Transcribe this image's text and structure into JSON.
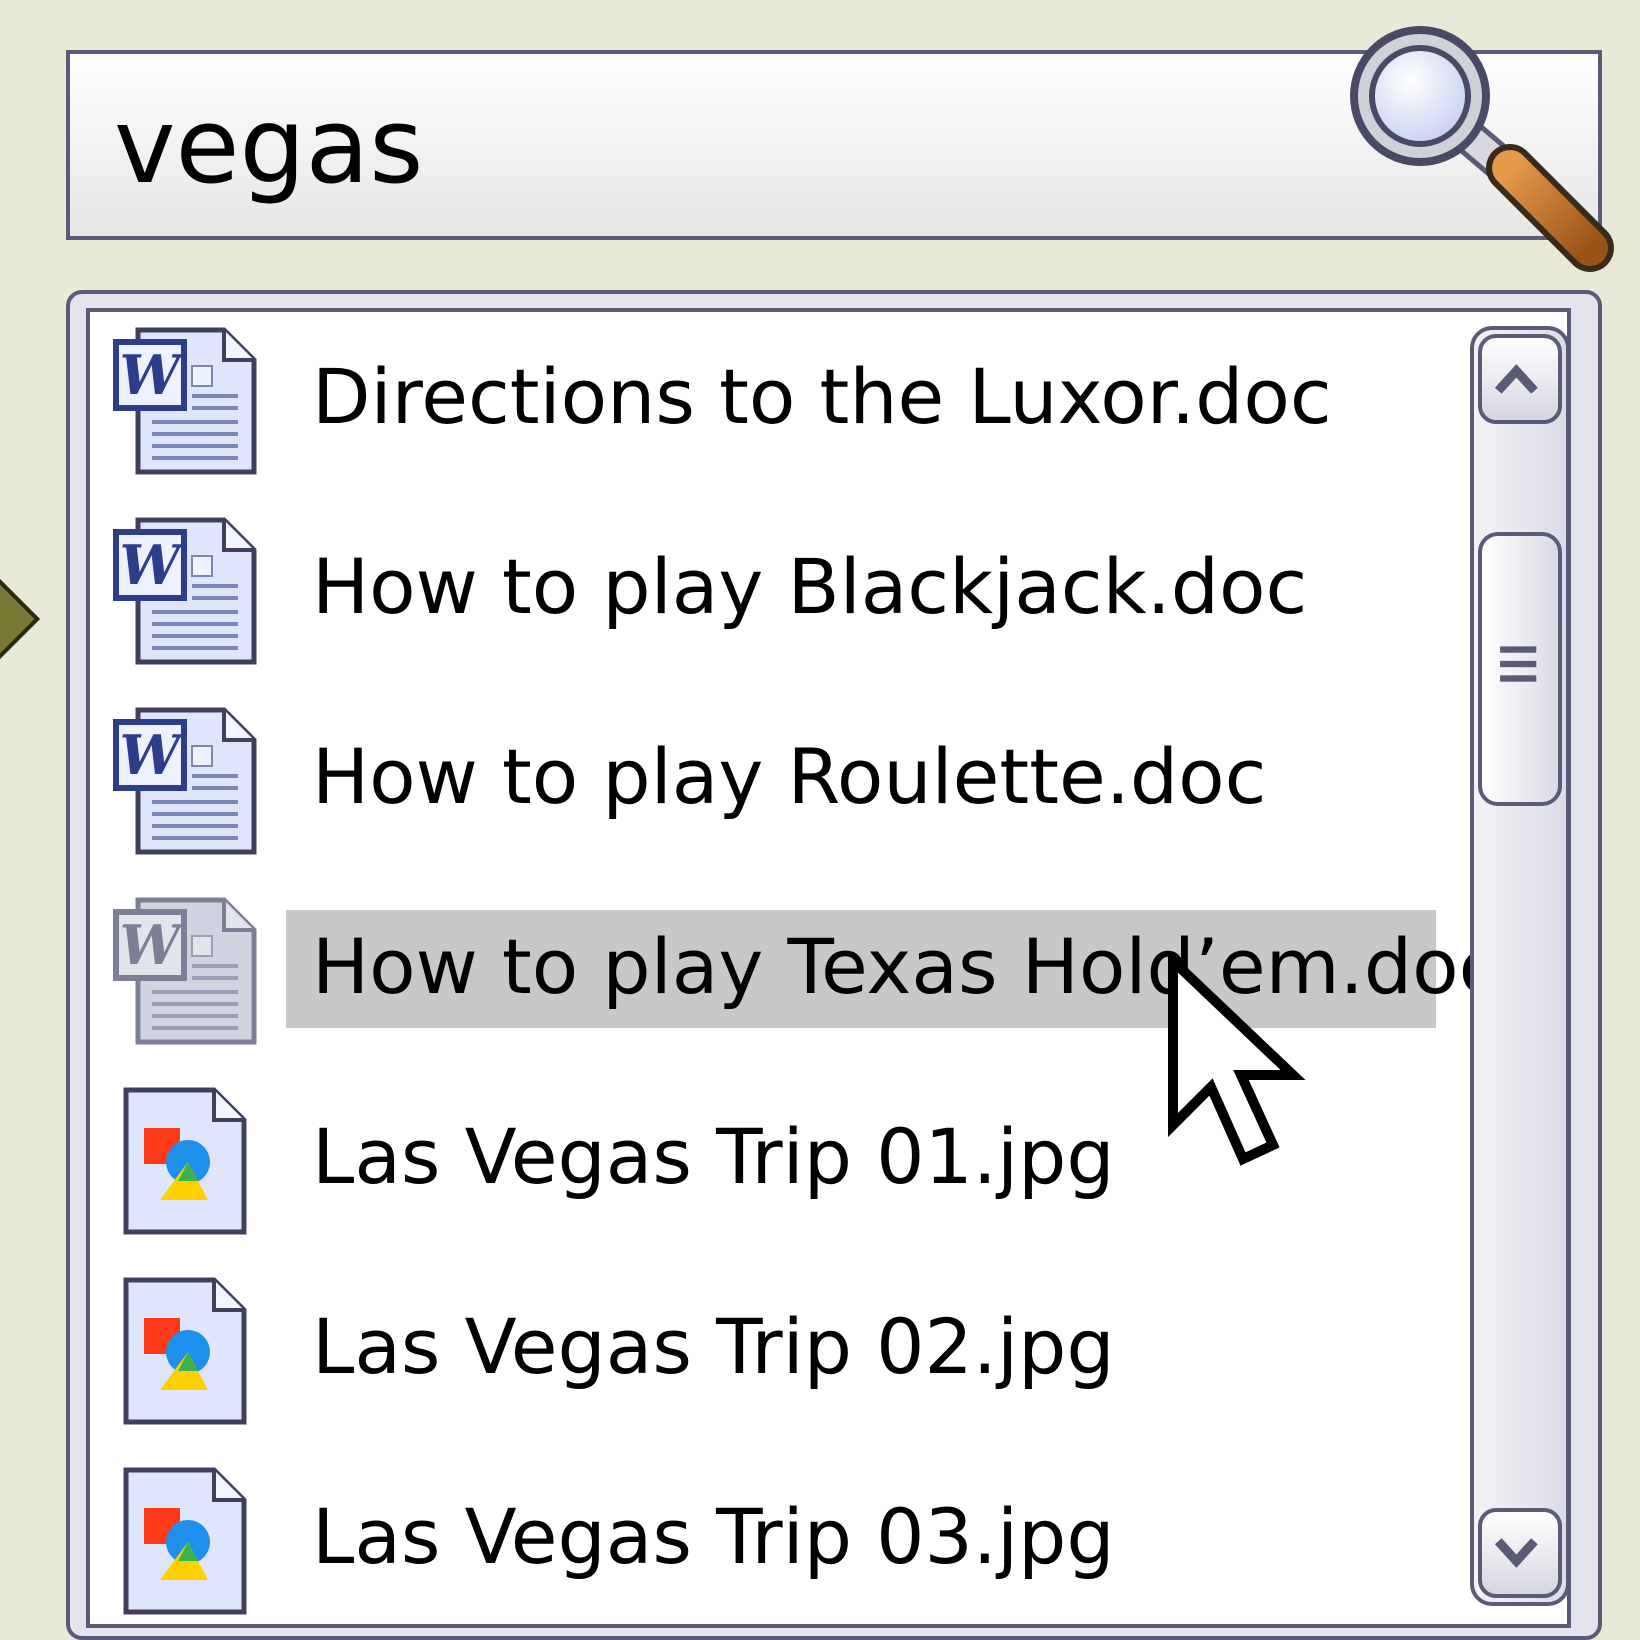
{
  "search": {
    "value": "vegas",
    "icon": "magnifier-icon"
  },
  "results": {
    "items": [
      {
        "label": "Directions to the Luxor.doc",
        "type": "word-doc",
        "selected": false
      },
      {
        "label": "How to play Blackjack.doc",
        "type": "word-doc",
        "selected": false
      },
      {
        "label": "How to play Roulette.doc",
        "type": "word-doc",
        "selected": false
      },
      {
        "label": "How to play Texas Hold’em.doc",
        "type": "word-doc",
        "selected": true
      },
      {
        "label": "Las Vegas Trip 01.jpg",
        "type": "image",
        "selected": false
      },
      {
        "label": "Las Vegas Trip 02.jpg",
        "type": "image",
        "selected": false
      },
      {
        "label": "Las Vegas Trip 03.jpg",
        "type": "image",
        "selected": false
      }
    ]
  },
  "scrollbar": {
    "up_icon": "chevron-up-icon",
    "down_icon": "chevron-down-icon",
    "thumb_icon": "grip-lines-icon"
  },
  "colors": {
    "background": "#e9e9d8",
    "border": "#5b5b78",
    "selection": "#c8c8c8",
    "magnifier_handle": "#c0702a"
  },
  "cursor": {
    "icon": "mouse-pointer-icon"
  }
}
